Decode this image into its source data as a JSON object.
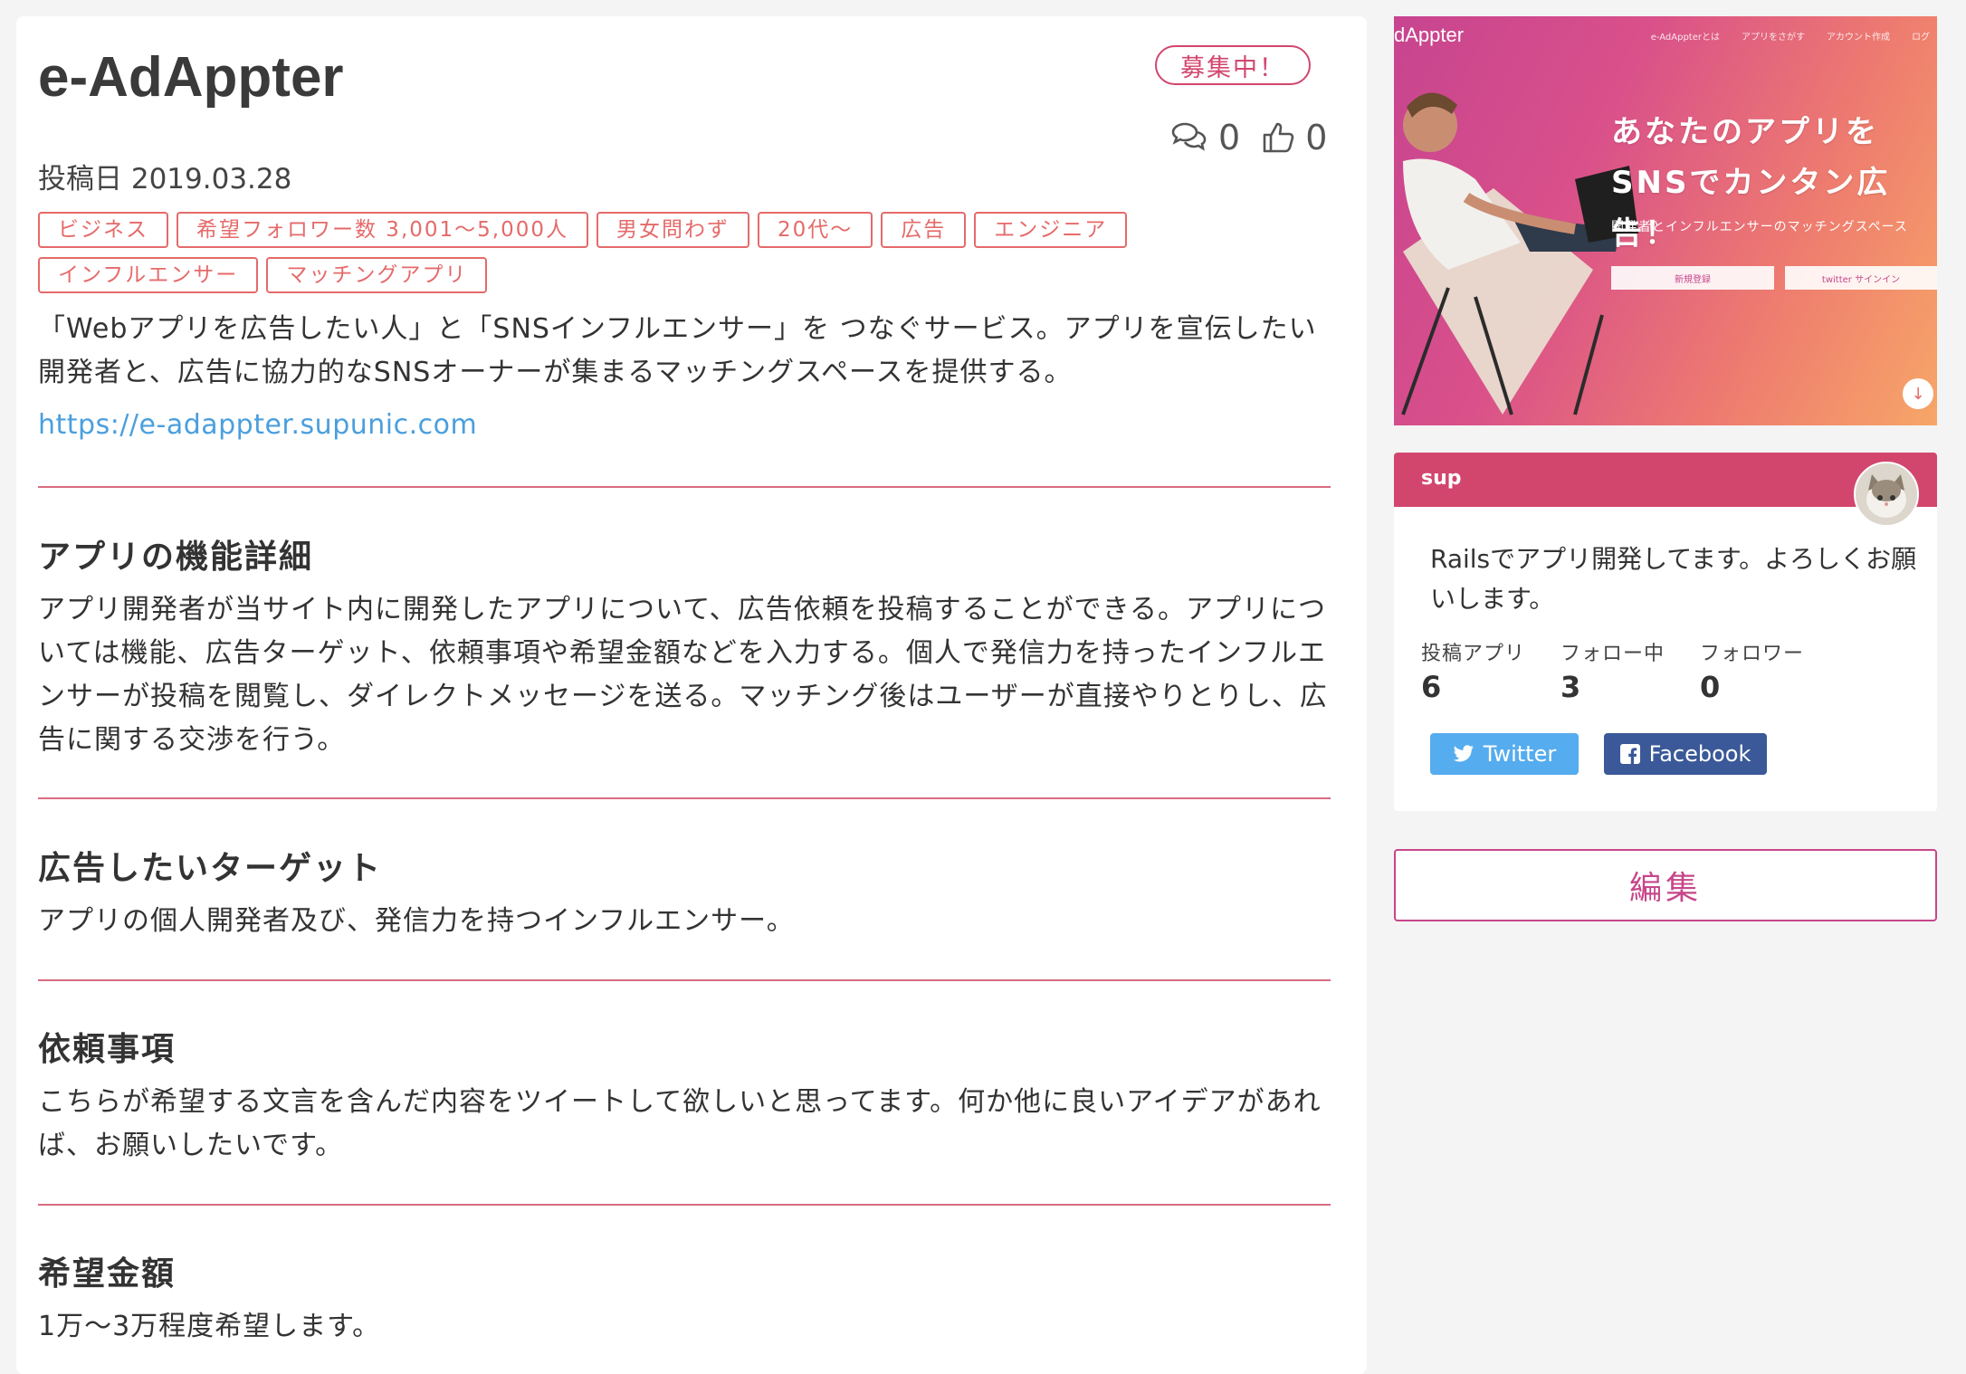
{
  "post": {
    "title": "e-AdAppter",
    "status": "募集中！",
    "comment_count": "0",
    "like_count": "0",
    "date_line": "投稿日 2019.03.28",
    "tags": [
      "ビジネス",
      "希望フォロワー数 3,001〜5,000人",
      "男女問わず",
      "20代〜",
      "広告",
      "エンジニア",
      "インフルエンサー",
      "マッチングアプリ"
    ],
    "description": "「Webアプリを広告したい人」と「SNSインフルエンサー」を つなぐサービス。アプリを宣伝したい開発者と、広告に協力的なSNSオーナーが集まるマッチングスペースを提供する。",
    "url": "https://e-adappter.supunic.com"
  },
  "sections": [
    {
      "title": "アプリの機能詳細",
      "body": "アプリ開発者が当サイト内に開発したアプリについて、広告依頼を投稿することができる。アプリについては機能、広告ターゲット、依頼事項や希望金額などを入力する。個人で発信力を持ったインフルエンサーが投稿を閲覧し、ダイレクトメッセージを送る。マッチング後はユーザーが直接やりとりし、広告に関する交渉を行う。"
    },
    {
      "title": "広告したいターゲット",
      "body": "アプリの個人開発者及び、発信力を持つインフルエンサー。"
    },
    {
      "title": "依頼事項",
      "body": "こちらが希望する文言を含んだ内容をツイートして欲しいと思ってます。何か他に良いアイデアがあれば、お願いしたいです。"
    },
    {
      "title": "希望金額",
      "body": "1万〜3万程度希望します。"
    }
  ],
  "hero": {
    "logo": "dAppter",
    "nav": [
      "e-AdAppterとは",
      "アプリをさがす",
      "アカウント作成",
      "ログ"
    ],
    "headline_1": "あなたのアプリを",
    "headline_2": "SNSでカンタン広告！",
    "subtitle": "開発者とインフルエンサーのマッチングスペース",
    "button_1": "新規登録",
    "button_2": "twitter サインイン"
  },
  "profile": {
    "name": "sup",
    "bio": "Railsでアプリ開発してます。よろしくお願いします。",
    "stats": [
      {
        "label": "投稿アプリ",
        "value": "6"
      },
      {
        "label": "フォロー中",
        "value": "3"
      },
      {
        "label": "フォロワー",
        "value": "0"
      }
    ],
    "twitter_label": "Twitter",
    "facebook_label": "Facebook"
  },
  "edit_label": "編集",
  "colors": {
    "accent": "#d2466e",
    "tag": "#e56a6a",
    "link": "#4a9fde",
    "twitter": "#55acee",
    "facebook": "#3b5998"
  }
}
